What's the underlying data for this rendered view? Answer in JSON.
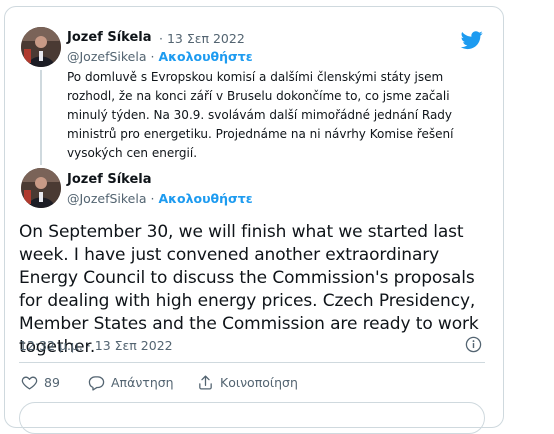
{
  "quoted_tweet": {
    "author_name": "Jozef Síkela",
    "timestamp": "· 13 Σεπ 2022",
    "handle": "@JozefSikela",
    "separator": " · ",
    "follow_label": "Ακολουθήστε",
    "text": "Po domluvě s Evropskou komisí a dalšími členskými státy jsem rozhodl, že na konci září v Bruselu dokončíme to, co jsme začali minulý týden. Na 30.9. svolávám další mimořádné jednání Rady ministrů pro energetiku. Projednáme na ni návrhy Komise řešení vysokých cen energií."
  },
  "main_tweet": {
    "author_name": "Jozef Síkela",
    "handle": "@JozefSikela",
    "separator": " · ",
    "follow_label": "Ακολουθήστε",
    "text": "On September 30, we will finish what we started last week. I have just convened another extraordinary Energy Council to discuss the Commission's proposals for dealing with high energy prices. Czech Presidency, Member States and the Commission are ready to work together.",
    "time": "12:32 μ.μ. · 13 Σεπ 2022"
  },
  "actions": {
    "like_count": "89",
    "reply_label": "Απάντηση",
    "share_label": "Κοινοποίηση"
  },
  "colors": {
    "accent": "#1d9bf0",
    "text": "#0f1419",
    "muted": "#536471",
    "border": "#cfd9de"
  },
  "icons": [
    "twitter-bird-icon",
    "info-icon",
    "heart-icon",
    "reply-icon",
    "share-icon"
  ]
}
